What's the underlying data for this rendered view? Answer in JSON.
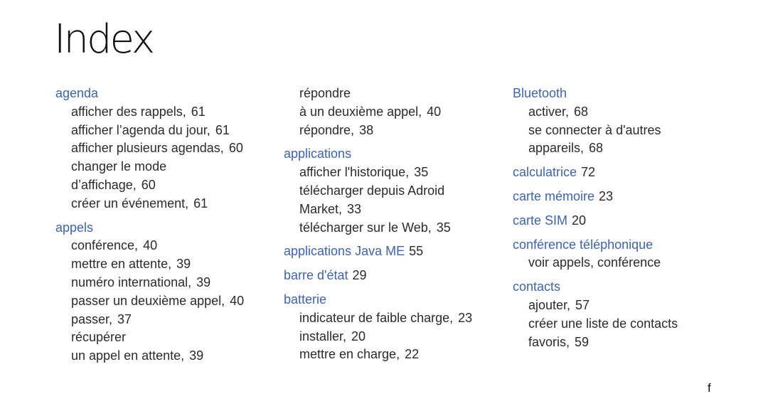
{
  "title": "Index",
  "columns": [
    {
      "entries": [
        {
          "term": "agenda",
          "page": null,
          "subs": [
            {
              "text": "afficher des rappels,",
              "page": "61"
            },
            {
              "text": "afficher l’agenda du jour,",
              "page": "61"
            },
            {
              "text": "afficher plusieurs agendas,",
              "page": "60"
            },
            {
              "text": "changer le mode",
              "page": null
            },
            {
              "text": "d’affichage,",
              "page": "60"
            },
            {
              "text": "créer un événement,",
              "page": "61"
            }
          ]
        },
        {
          "term": "appels",
          "page": null,
          "subs": [
            {
              "text": "conférence,",
              "page": "40"
            },
            {
              "text": "mettre en attente,",
              "page": "39"
            },
            {
              "text": "numéro international,",
              "page": "39"
            },
            {
              "text": "passer un deuxième appel,",
              "page": "40"
            },
            {
              "text": "passer,",
              "page": "37"
            },
            {
              "text": "récupérer",
              "page": null
            },
            {
              "text": "un appel en attente,",
              "page": "39"
            }
          ]
        }
      ]
    },
    {
      "continuation": [
        {
          "text": "répondre",
          "page": null
        },
        {
          "text": "à un deuxième appel,",
          "page": "40"
        },
        {
          "text": "répondre,",
          "page": "38"
        }
      ],
      "entries": [
        {
          "term": "applications",
          "page": null,
          "subs": [
            {
              "text": "afficher l'historique,",
              "page": "35"
            },
            {
              "text": "télécharger depuis Adroid",
              "page": null
            },
            {
              "text": "Market,",
              "page": "33"
            },
            {
              "text": "télécharger sur le Web,",
              "page": "35"
            }
          ]
        },
        {
          "term": "applications Java ME",
          "page": "55",
          "subs": []
        },
        {
          "term": "barre d'état",
          "page": "29",
          "subs": []
        },
        {
          "term": "batterie",
          "page": null,
          "subs": [
            {
              "text": "indicateur de faible charge,",
              "page": "23"
            },
            {
              "text": "installer,",
              "page": "20"
            },
            {
              "text": "mettre en charge,",
              "page": "22"
            }
          ]
        }
      ]
    },
    {
      "entries": [
        {
          "term": "Bluetooth",
          "page": null,
          "subs": [
            {
              "text": "activer,",
              "page": "68"
            },
            {
              "text": "se connecter à d'autres",
              "page": null
            },
            {
              "text": "appareils,",
              "page": "68"
            }
          ]
        },
        {
          "term": "calculatrice",
          "page": "72",
          "subs": []
        },
        {
          "term": "carte mémoire",
          "page": "23",
          "subs": []
        },
        {
          "term": "carte SIM",
          "page": "20",
          "subs": []
        },
        {
          "term": "conférence téléphonique",
          "page": null,
          "subs": [
            {
              "text": "voir appels, conférence",
              "page": null
            }
          ]
        },
        {
          "term": "contacts",
          "page": null,
          "subs": [
            {
              "text": "ajouter,",
              "page": "57"
            },
            {
              "text": "créer une liste de contacts",
              "page": null
            },
            {
              "text": "favoris,",
              "page": "59"
            }
          ]
        }
      ]
    }
  ],
  "footer_mark": "f",
  "colors": {
    "heading": "#3d63b8",
    "text": "#2b2b2b",
    "title": "#111111"
  }
}
